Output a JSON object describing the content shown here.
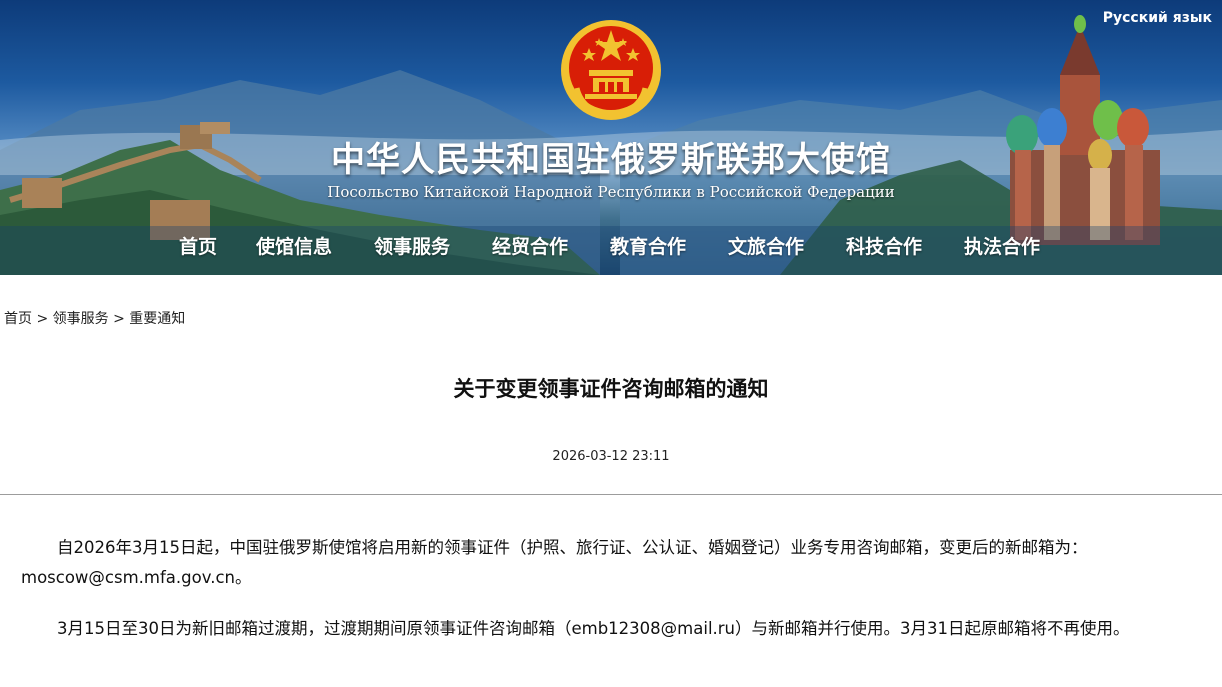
{
  "header": {
    "lang_link": "Русский язык",
    "title_cn": "中华人民共和国驻俄罗斯联邦大使馆",
    "title_ru": "Посольство Китайской Народной Республики в Российской Федерации"
  },
  "nav": {
    "items": [
      {
        "label": "首页"
      },
      {
        "label": "使馆信息"
      },
      {
        "label": "领事服务"
      },
      {
        "label": "经贸合作"
      },
      {
        "label": "教育合作"
      },
      {
        "label": "文旅合作"
      },
      {
        "label": "科技合作"
      },
      {
        "label": "执法合作"
      }
    ]
  },
  "breadcrumb": {
    "items": [
      "首页",
      "领事服务",
      "重要通知"
    ],
    "separator": ">"
  },
  "article": {
    "title": "关于变更领事证件咨询邮箱的通知",
    "date": "2026-03-12 23:11",
    "paragraphs": [
      "自2026年3月15日起，中国驻俄罗斯使馆将启用新的领事证件（护照、旅行证、公认证、婚姻登记）业务专用咨询邮箱，变更后的新邮箱为：moscow@csm.mfa.gov.cn。",
      "3月15日至30日为新旧邮箱过渡期，过渡期期间原领事证件咨询邮箱（emb12308@mail.ru）与新邮箱并行使用。3月31日起原邮箱将不再使用。"
    ]
  },
  "colors": {
    "banner_top": "#0d3b7a",
    "emblem_red": "#d81e06",
    "emblem_gold": "#f2c230"
  }
}
